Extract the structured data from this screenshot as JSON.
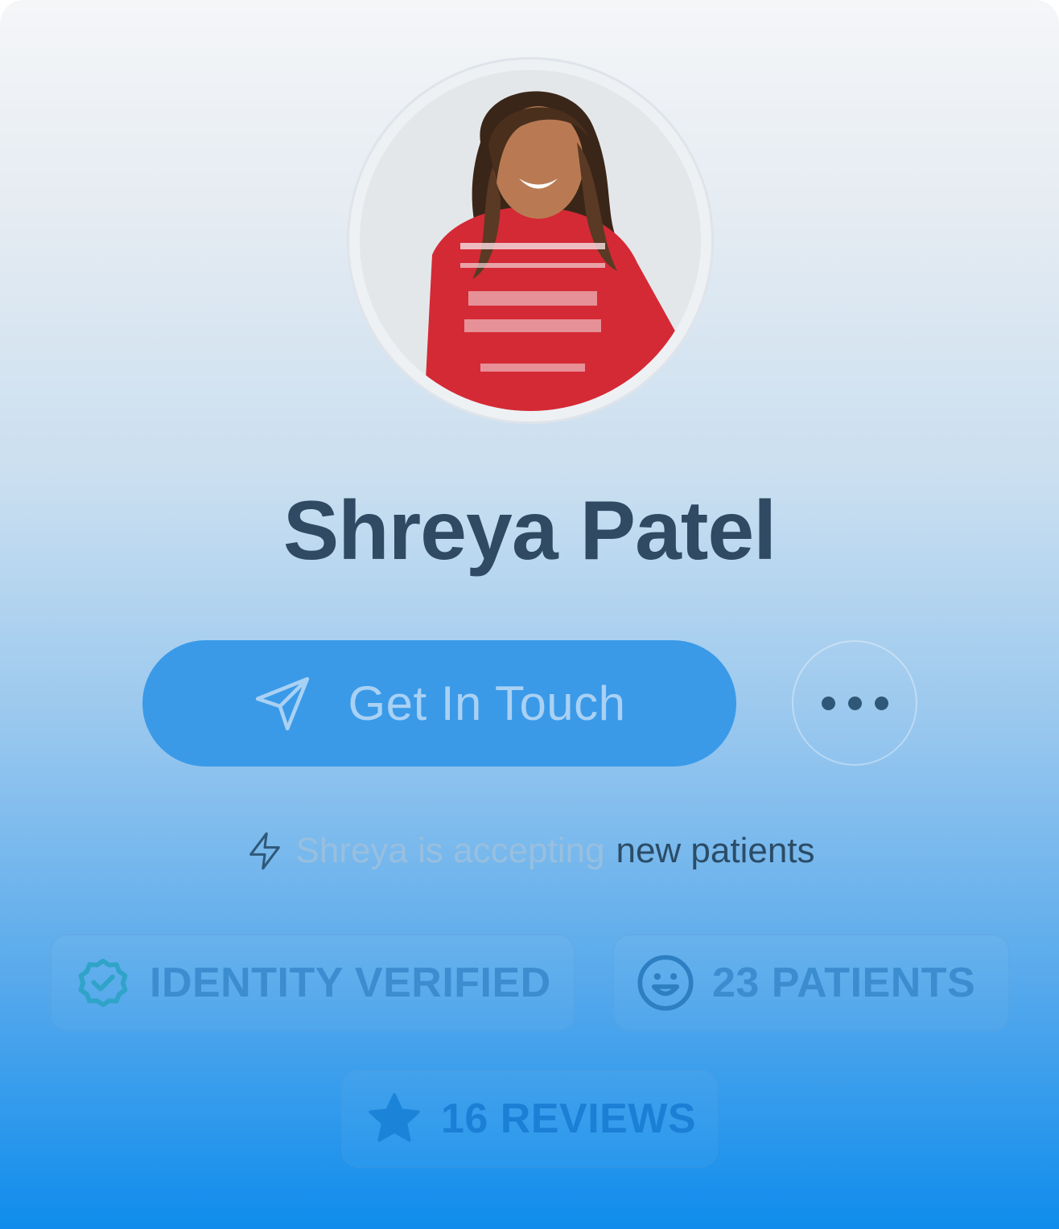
{
  "profile": {
    "name": "Shreya Patel",
    "avatar_alt": "avatar-photo"
  },
  "actions": {
    "primary_label": "Get In Touch",
    "primary_icon": "send-icon",
    "more_icon": "more-horizontal-icon"
  },
  "status": {
    "icon": "lightning-icon",
    "muted_text": "Shreya is accepting",
    "strong_text": "new patients"
  },
  "badges": [
    {
      "icon": "verified-badge-icon",
      "label": "IDENTITY VERIFIED"
    },
    {
      "icon": "smiley-face-icon",
      "label": "23 PATIENTS"
    },
    {
      "icon": "star-icon",
      "label": "16 REVIEWS"
    }
  ],
  "colors": {
    "name_text": "#2f4a62",
    "cta_bg": "#3a9ae8",
    "cta_text": "#a9d1f4",
    "status_muted": "#9cc0de",
    "status_strong": "#2b4c67",
    "verified_icon": "#2fa3c8",
    "badge_text": "#3c8cd0",
    "patients_icon": "#2d7fc1",
    "reviews_text": "#1b7fd6"
  }
}
